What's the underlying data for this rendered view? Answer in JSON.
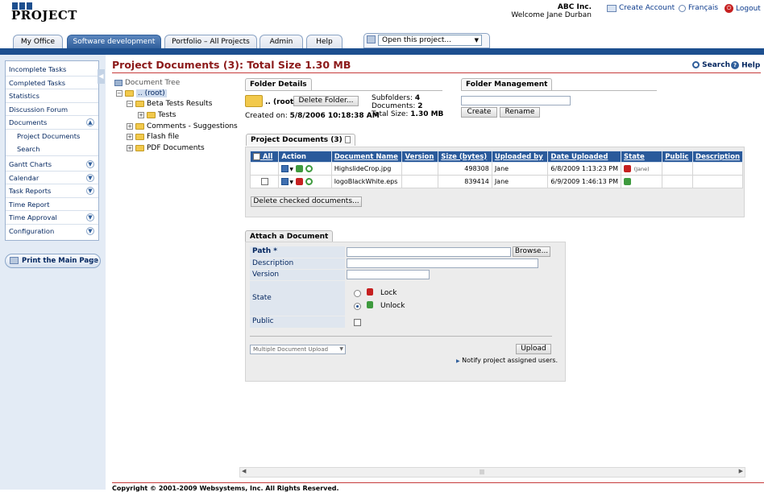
{
  "header": {
    "logo_mark": "AGE",
    "logo_text": "PROJECT",
    "company": "ABC Inc.",
    "welcome": "Welcome Jane Durban",
    "create_account": "Create Account",
    "language": "Français",
    "logout": "Logout"
  },
  "tabs": [
    {
      "label": "My Office"
    },
    {
      "label": "Software development"
    },
    {
      "label": "Portfolio – All Projects"
    },
    {
      "label": "Admin"
    },
    {
      "label": "Help"
    }
  ],
  "open_project": {
    "value": "Open this project..."
  },
  "sidebar": {
    "items": [
      {
        "label": "Incomplete Tasks"
      },
      {
        "label": "Completed Tasks"
      },
      {
        "label": "Statistics"
      },
      {
        "label": "Discussion Forum"
      },
      {
        "label": "Documents"
      },
      {
        "label": "Project Documents"
      },
      {
        "label": "Search"
      },
      {
        "label": "Gantt Charts"
      },
      {
        "label": "Calendar"
      },
      {
        "label": "Task Reports"
      },
      {
        "label": "Time Report"
      },
      {
        "label": "Time Approval"
      },
      {
        "label": "Configuration"
      }
    ],
    "print_label": "Print the Main Page"
  },
  "page": {
    "title": "Project Documents (3): Total Size 1.30 MB",
    "search": "Search",
    "help": "Help"
  },
  "tree": {
    "title": "Document Tree",
    "nodes": [
      {
        "label": ".. (root)"
      },
      {
        "label": "Beta Tests Results"
      },
      {
        "label": "Tests"
      },
      {
        "label": "Comments - Suggestions"
      },
      {
        "label": "Flash file"
      },
      {
        "label": "PDF Documents"
      }
    ]
  },
  "folder_details": {
    "tab": "Folder Details",
    "folder_name": ".. (root)",
    "delete_btn": "Delete Folder...",
    "created_label": "Created on:",
    "created_value": "5/8/2006 10:18:38 AM",
    "subfolders_label": "Subfolders:",
    "subfolders_value": "4",
    "documents_label": "Documents:",
    "documents_value": "2",
    "total_label": "Total Size:",
    "total_value": "1.30 MB"
  },
  "folder_management": {
    "tab": "Folder Management",
    "create_btn": "Create",
    "rename_btn": "Rename"
  },
  "documents": {
    "tab": "Project Documents (3)",
    "columns": [
      "All",
      "Action",
      "Document Name",
      "Version",
      "Size (bytes)",
      "Uploaded by",
      "Date Uploaded",
      "State",
      "Public",
      "Description"
    ],
    "rows": [
      {
        "name": "HighslideCrop.jpg",
        "version": "",
        "size": "498308",
        "uploaded_by": "Jane",
        "date": "6/8/2009 1:13:23 PM",
        "state_note": "(Jane)",
        "public": "",
        "description": ""
      },
      {
        "name": "logoBlackWhite.eps",
        "version": "",
        "size": "839414",
        "uploaded_by": "Jane",
        "date": "6/9/2009 1:46:13 PM",
        "state_note": "",
        "public": "",
        "description": ""
      }
    ],
    "delete_checked": "Delete checked documents..."
  },
  "attach": {
    "tab": "Attach a Document",
    "path_label": "Path *",
    "browse": "Browse...",
    "description_label": "Description",
    "version_label": "Version",
    "state_label": "State",
    "lock_label": "Lock",
    "unlock_label": "Unlock",
    "public_label": "Public",
    "upload_mode": "Multiple Document Upload",
    "upload_btn": "Upload",
    "notify": "Notify project assigned users."
  },
  "footer": {
    "text": "Copyright © 2001-2009 Websystems, Inc. All Rights Reserved."
  },
  "colors": {
    "nav_blue": "#1d4f8f",
    "title_red": "#8c1a1a",
    "table_header": "#2a5a9b"
  }
}
